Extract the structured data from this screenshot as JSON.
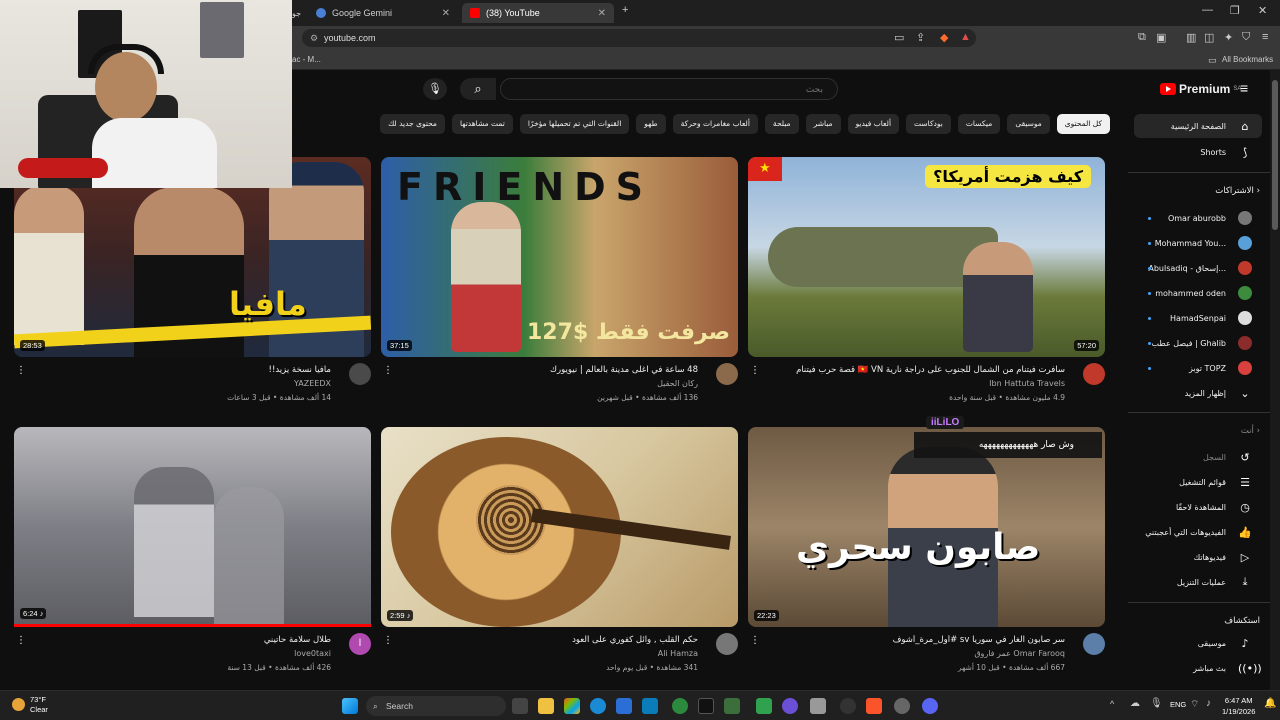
{
  "browser": {
    "tabs": [
      {
        "label": "Google Gemini"
      },
      {
        "label": "(38) YouTube"
      }
    ],
    "tab_truncated_left": "جو",
    "url": "youtube.com",
    "bookmarks_left": "ac - M...",
    "bookmarks_right": "All Bookmarks",
    "new_tab": "+"
  },
  "youtube": {
    "logo_text": "Premium",
    "logo_region": "SA",
    "search": {
      "placeholder": "بحث",
      "value": ""
    },
    "chips": [
      "كل المحتوى",
      "موسيقى",
      "ميكسات",
      "بودكاست",
      "ألعاب فيديو",
      "مباشر",
      "مبلحة",
      "ألعاب مغامرات وحركة",
      "طهو",
      "القنوات التي تم تحميلها مؤخرًا",
      "تمت مشاهدتها",
      "محتوى جديد لك"
    ],
    "sidebar": {
      "home": "الصفحة الرئيسية",
      "shorts": "Shorts",
      "subscriptions_header": "الاشتراكات",
      "subscriptions": [
        {
          "name": "Omar aburobb",
          "color": "#777777"
        },
        {
          "name": "Mohammad You...",
          "color": "#5aa0d8"
        },
        {
          "name": "Abulsadiq - إسحاق...",
          "color": "#c0392b"
        },
        {
          "name": "mohammed oden",
          "color": "#3d8b3d"
        },
        {
          "name": "HamadSenpai",
          "color": "#dddddd"
        },
        {
          "name": "فيصل عطب | Ghalib",
          "color": "#8b2c2c"
        },
        {
          "name": "توبز TOPZ",
          "color": "#d9413e"
        }
      ],
      "show_more": "إظهار المزيد",
      "you_header": "أنت",
      "you_items": [
        {
          "label": "السجل",
          "icon": "history-icon"
        },
        {
          "label": "قوائم التشغيل",
          "icon": "playlist-icon"
        },
        {
          "label": "المشاهدة لاحقًا",
          "icon": "watch-later-icon"
        },
        {
          "label": "الفيديوهات التي أعجبتني",
          "icon": "like-icon"
        },
        {
          "label": "فيديوهاتك",
          "icon": "your-videos-icon"
        },
        {
          "label": "عمليات التنزيل",
          "icon": "download-icon"
        }
      ],
      "explore_header": "استكشاف",
      "explore_items": [
        {
          "label": "موسيقى",
          "icon": "music-icon"
        },
        {
          "label": "بث مباشر",
          "icon": "live-icon"
        }
      ]
    },
    "videos": [
      {
        "title": "سافرت فيتنام من الشمال للجنوب على دراجة نارية 🇻🇳 VN قصة حرب فيتنام",
        "channel": "Ibn Hattuta Travels",
        "meta": "4.9 مليون مشاهدة • قبل سنة واحدة",
        "duration": "57:20",
        "thumb_text": "كيف هزمت أمريكا؟",
        "avatar_color": "#c0392b"
      },
      {
        "title": "48 ساعة في اغلى مدينة بالعالم | نيويورك",
        "channel": "ركان الحقيل",
        "meta": "136 ألف مشاهدة • قبل شهرين",
        "duration": "37:15",
        "thumb_text": "FRIENDS",
        "thumb_text2": "صرفت فقط $127",
        "avatar_color": "#8a6a4a"
      },
      {
        "title": "مافيا نسخة يزيد!!",
        "channel": "YAZEEDX",
        "meta": "14 ألف مشاهدة • قبل 3 ساعات",
        "duration": "28:53",
        "thumb_text": "مافيا",
        "avatar_color": "#4a4a4a"
      },
      {
        "title": "سر صابون الغار في سوريا sv #أول_مرة_أشوف",
        "channel": "عمر فاروق Omar Farooq",
        "meta": "667 ألف مشاهدة • قبل 10 أشهر",
        "duration": "22:23",
        "thumb_text": "صابون سحري",
        "avatar_color": "#5b7fa8"
      },
      {
        "title": "حكم القلب , وائل كفوري على العود",
        "channel": "Ali Hamza",
        "meta": "341 مشاهدة • قبل يوم واحد",
        "duration": "2:59",
        "avatar_color": "#777777"
      },
      {
        "title": "طلال سلامة حاتيني",
        "channel": "love0taxi",
        "meta": "426 ألف مشاهدة • قبل 13 سنة",
        "duration": "6:24",
        "avatar_color": "#b04ab0",
        "avatar_letter": "l",
        "progress": 1.0
      }
    ],
    "chat": {
      "user": "iiLiLO",
      "message": "وش صار هههههههههههههه"
    }
  },
  "taskbar": {
    "weather_temp": "73°F",
    "weather_desc": "Clear",
    "search_label": "Search",
    "lang": "ENG",
    "time": "6:47 AM",
    "date": "1/19/2026"
  }
}
